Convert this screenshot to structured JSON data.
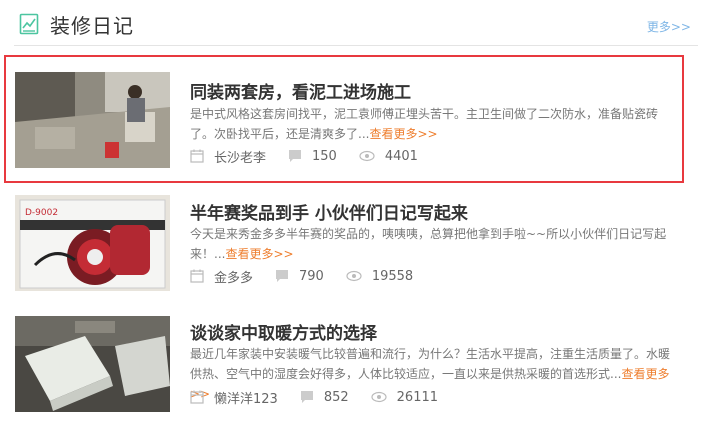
{
  "header": {
    "title": "装修日记",
    "more": "更多>>"
  },
  "items": [
    {
      "title": "同装两套房，看泥工进场施工",
      "desc": "是中式风格这套房间找平，泥工袁师傅正埋头苦干。主卫生间做了二次防水，准备贴瓷砖了。次卧找平后，还是清爽多了...",
      "more": "查看更多>>",
      "author": "长沙老李",
      "comments": "150",
      "views": "4401"
    },
    {
      "title": "半年赛奖品到手 小伙伴们日记写起来",
      "desc": "今天是来秀金多多半年赛的奖品的，咦咦咦，总算把他拿到手啦~~所以小伙伴们日记写起来！...",
      "more": "查看更多>>",
      "author": "金多多",
      "comments": "790",
      "views": "19558",
      "box_label": "D-9002"
    },
    {
      "title": "谈谈家中取暖方式的选择",
      "desc": "最近几年家装中安装暖气比较普遍和流行，为什么？生活水平提高，注重生活质量了。水暖供热、空气中的湿度会好得多，人体比较适应，一直以来是供热采暖的首选形式...",
      "more": "查看更多>>",
      "author": "懒洋洋123",
      "comments": "852",
      "views": "26111"
    }
  ],
  "colors": {
    "accent_more": "#ee7e2e",
    "link_blue": "#7fb6e6",
    "highlight_border": "#e8393f",
    "header_icon": "#4cc5a0"
  }
}
